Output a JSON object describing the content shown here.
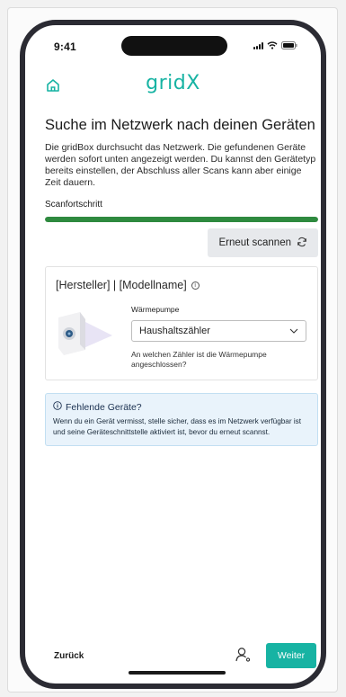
{
  "status_bar": {
    "time": "9:41"
  },
  "header": {
    "brand": "gridX"
  },
  "main": {
    "title": "Suche im Netzwerk nach deinen Geräten",
    "intro": "Die gridBox durchsucht das Netzwerk. Die gefundenen Geräte werden sofort unten angezeigt werden. Du kannst den Gerätetyp bereits einstellen, der Abschluss aller Scans kann aber einige Zeit dauern.",
    "scan_label": "Scanfortschritt",
    "scan_progress": 1.0,
    "progress_color": "#2e8a3f",
    "rescan_label": "Erneut scannen"
  },
  "device": {
    "heading": "[Hersteller] | [Modellname]",
    "field_label": "Wärmepumpe",
    "selected_value": "Haushaltszähler",
    "hint": "An welchen Zähler ist die Wärmepumpe angeschlossen?"
  },
  "notice": {
    "title": "Fehlende Geräte?",
    "text": "Wenn du ein Gerät vermisst, stelle sicher, dass es im Netzwerk verfügbar ist und seine Geräteschnittstelle aktiviert ist, bevor du erneut scannst."
  },
  "footer": {
    "back_label": "Zurück",
    "next_label": "Weiter"
  },
  "colors": {
    "accent": "#17b3a3",
    "notice_bg": "#e9f3fb"
  }
}
